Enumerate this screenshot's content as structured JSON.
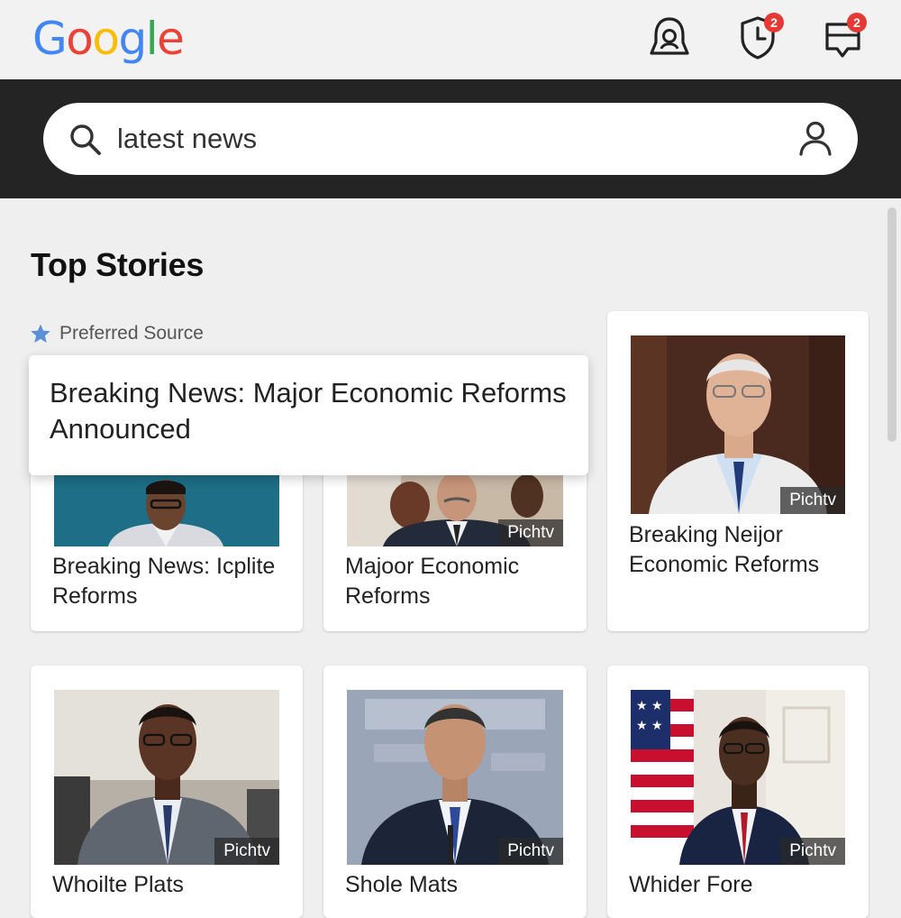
{
  "header": {
    "logo_letters": [
      {
        "char": "G",
        "color": "#4285F4"
      },
      {
        "char": "o",
        "color": "#EA4335"
      },
      {
        "char": "o",
        "color": "#FBBC05"
      },
      {
        "char": "g",
        "color": "#4285F4"
      },
      {
        "char": "l",
        "color": "#34A853"
      },
      {
        "char": "e",
        "color": "#EA4335"
      }
    ],
    "icons": [
      {
        "name": "bell-icon",
        "badge": null
      },
      {
        "name": "clock-shield-icon",
        "badge": "2"
      },
      {
        "name": "message-icon",
        "badge": "2"
      }
    ],
    "badge_color": "#E53935"
  },
  "search": {
    "query": "latest news",
    "left_icon": "search-icon",
    "right_icon": "account-icon"
  },
  "main": {
    "section_title": "Top Stories",
    "preferred_source_label": "Preferred Source",
    "preferred_source_icon": "star-icon",
    "star_color": "#5B8FD8",
    "popup_title": "Breaking News: Major Economic Reforms Announced",
    "cards": [
      {
        "title": "Breaking News: Icplite Reforms",
        "source": ""
      },
      {
        "title": "Majoor Economic Reforms",
        "source": "Pichtv"
      },
      {
        "title": "Breaking Neijor Economic Reforms",
        "source": "Pichtv"
      },
      {
        "title": "Whoilte Plats",
        "source": "Pichtv"
      },
      {
        "title": "Shole Mats",
        "source": "Pichtv"
      },
      {
        "title": "Whider Fore",
        "source": "Pichtv"
      }
    ]
  }
}
